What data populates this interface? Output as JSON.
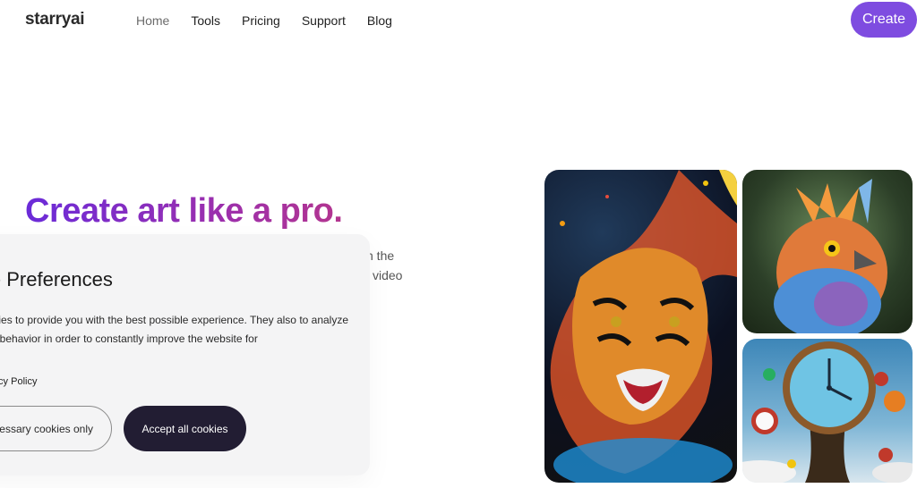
{
  "header": {
    "logo": "starryai",
    "nav": [
      "Home",
      "Tools",
      "Pricing",
      "Support",
      "Blog"
    ],
    "create_label": "Create"
  },
  "hero": {
    "title": "Create art like a pro.",
    "line1_fragment": "h the",
    "line2_fragment": "video"
  },
  "cookie": {
    "title": "kie Preferences",
    "text": "cookies to provide you with the best possible experience. They also  to analyze user behavior in order to constantly improve the website for",
    "privacy_link": "Privacy Policy",
    "necessary_label": "essary cookies only",
    "accept_label": "Accept all cookies"
  },
  "colors": {
    "accent": "#7e4ce0",
    "dark_button": "#221d33",
    "cookie_bg": "#f4f4f5"
  },
  "gallery": {
    "images": [
      "tiger-painting",
      "bird-painting",
      "melting-clock-painting"
    ]
  }
}
